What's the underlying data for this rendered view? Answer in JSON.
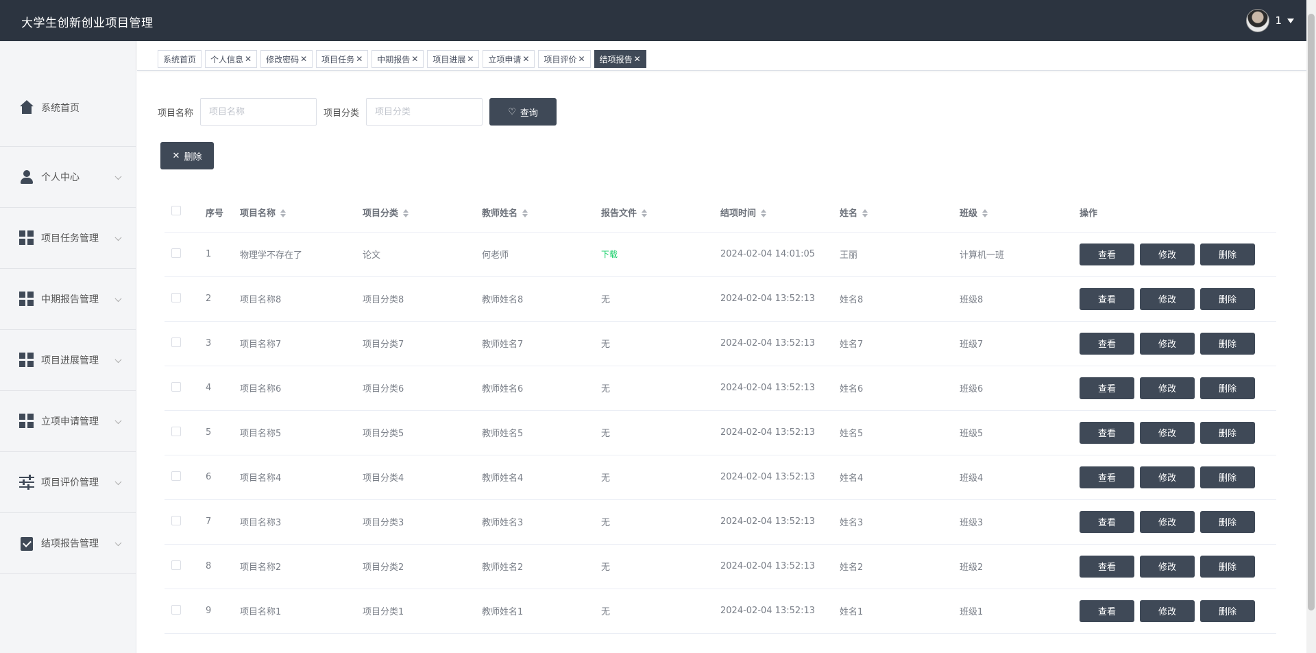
{
  "app": {
    "title": "大学生创新创业项目管理",
    "user_name": "1"
  },
  "sidebar": {
    "items": [
      {
        "label": "系统首页",
        "icon": "home-icon"
      },
      {
        "label": "个人中心",
        "icon": "user-icon"
      },
      {
        "label": "项目任务管理",
        "icon": "grid-icon"
      },
      {
        "label": "中期报告管理",
        "icon": "grid-icon"
      },
      {
        "label": "项目进展管理",
        "icon": "grid-icon"
      },
      {
        "label": "立项申请管理",
        "icon": "grid-icon"
      },
      {
        "label": "项目评价管理",
        "icon": "sliders-icon"
      },
      {
        "label": "结项报告管理",
        "icon": "clipboard-check-icon"
      }
    ]
  },
  "tabs": [
    {
      "label": "系统首页",
      "closable": false,
      "active": false
    },
    {
      "label": "个人信息",
      "closable": true,
      "active": false
    },
    {
      "label": "修改密码",
      "closable": true,
      "active": false
    },
    {
      "label": "项目任务",
      "closable": true,
      "active": false
    },
    {
      "label": "中期报告",
      "closable": true,
      "active": false
    },
    {
      "label": "项目进展",
      "closable": true,
      "active": false
    },
    {
      "label": "立项申请",
      "closable": true,
      "active": false
    },
    {
      "label": "项目评价",
      "closable": true,
      "active": false
    },
    {
      "label": "结项报告",
      "closable": true,
      "active": true
    }
  ],
  "search": {
    "name_label": "项目名称",
    "name_placeholder": "项目名称",
    "category_label": "项目分类",
    "category_placeholder": "项目分类",
    "query_label": "查询"
  },
  "toolbar": {
    "delete_label": "删除"
  },
  "table": {
    "headers": {
      "index": "序号",
      "project_name": "项目名称",
      "category": "项目分类",
      "teacher": "教师姓名",
      "report_file": "报告文件",
      "finish_time": "结项时间",
      "student_name": "姓名",
      "class": "班级",
      "actions": "操作"
    },
    "action_labels": {
      "view": "查看",
      "edit": "修改",
      "delete": "删除"
    },
    "rows": [
      {
        "index": "1",
        "project_name": "物理学不存在了",
        "category": "论文",
        "teacher": "何老师",
        "report_file": "下载",
        "has_file": true,
        "finish_time": "2024-02-04 14:01:05",
        "student_name": "王丽",
        "class": "计算机一班"
      },
      {
        "index": "2",
        "project_name": "项目名称8",
        "category": "项目分类8",
        "teacher": "教师姓名8",
        "report_file": "无",
        "has_file": false,
        "finish_time": "2024-02-04 13:52:13",
        "student_name": "姓名8",
        "class": "班级8"
      },
      {
        "index": "3",
        "project_name": "项目名称7",
        "category": "项目分类7",
        "teacher": "教师姓名7",
        "report_file": "无",
        "has_file": false,
        "finish_time": "2024-02-04 13:52:13",
        "student_name": "姓名7",
        "class": "班级7"
      },
      {
        "index": "4",
        "project_name": "项目名称6",
        "category": "项目分类6",
        "teacher": "教师姓名6",
        "report_file": "无",
        "has_file": false,
        "finish_time": "2024-02-04 13:52:13",
        "student_name": "姓名6",
        "class": "班级6"
      },
      {
        "index": "5",
        "project_name": "项目名称5",
        "category": "项目分类5",
        "teacher": "教师姓名5",
        "report_file": "无",
        "has_file": false,
        "finish_time": "2024-02-04 13:52:13",
        "student_name": "姓名5",
        "class": "班级5"
      },
      {
        "index": "6",
        "project_name": "项目名称4",
        "category": "项目分类4",
        "teacher": "教师姓名4",
        "report_file": "无",
        "has_file": false,
        "finish_time": "2024-02-04 13:52:13",
        "student_name": "姓名4",
        "class": "班级4"
      },
      {
        "index": "7",
        "project_name": "项目名称3",
        "category": "项目分类3",
        "teacher": "教师姓名3",
        "report_file": "无",
        "has_file": false,
        "finish_time": "2024-02-04 13:52:13",
        "student_name": "姓名3",
        "class": "班级3"
      },
      {
        "index": "8",
        "project_name": "项目名称2",
        "category": "项目分类2",
        "teacher": "教师姓名2",
        "report_file": "无",
        "has_file": false,
        "finish_time": "2024-02-04 13:52:13",
        "student_name": "姓名2",
        "class": "班级2"
      },
      {
        "index": "9",
        "project_name": "项目名称1",
        "category": "项目分类1",
        "teacher": "教师姓名1",
        "report_file": "无",
        "has_file": false,
        "finish_time": "2024-02-04 13:52:13",
        "student_name": "姓名1",
        "class": "班级1"
      }
    ]
  },
  "colors": {
    "header_bg": "#2c3440",
    "button_dark": "#3f4957",
    "download_link": "#13ce66"
  }
}
